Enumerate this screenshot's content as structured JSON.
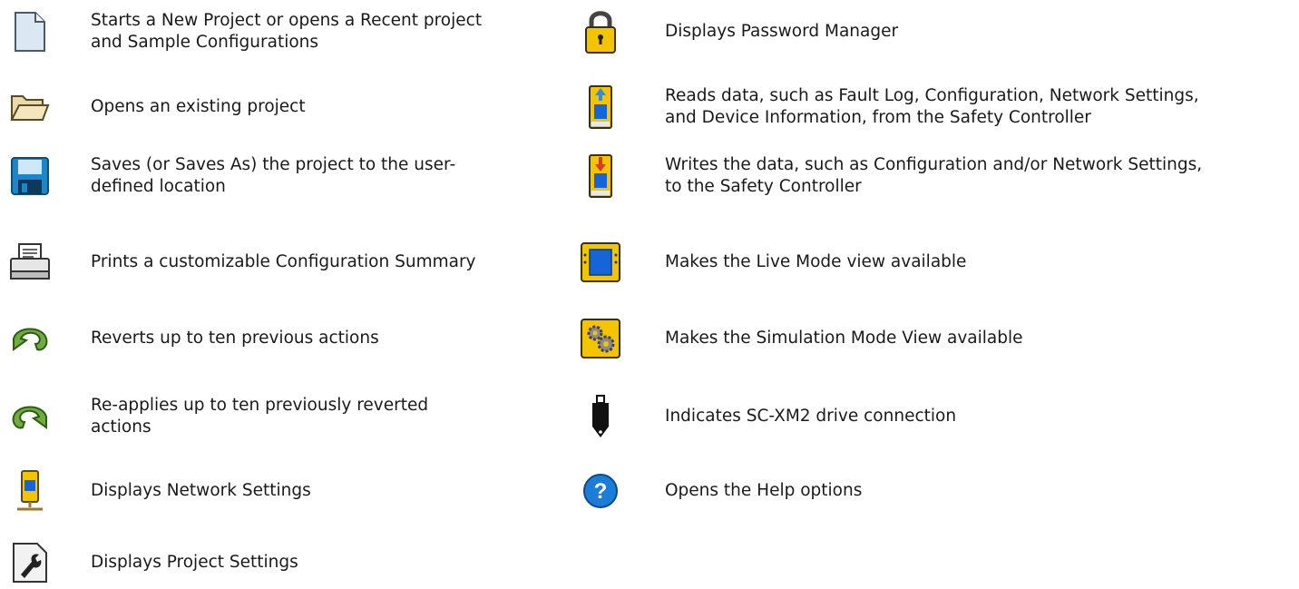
{
  "left": [
    {
      "icon": "new-project-icon",
      "line1": "Starts a New Project or opens a Recent project",
      "line2": "and Sample Configurations"
    },
    {
      "icon": "open-folder-icon",
      "line1": "Opens an existing project",
      "line2": ""
    },
    {
      "icon": "save-disk-icon",
      "line1": "Saves (or Saves As) the project to the user-",
      "line2": "defined location"
    },
    {
      "icon": "printer-icon",
      "line1": "Prints a customizable Configuration Summary",
      "line2": ""
    },
    {
      "icon": "undo-arrow-icon",
      "line1": "Reverts up to ten previous actions",
      "line2": ""
    },
    {
      "icon": "redo-arrow-icon",
      "line1": "Re-applies up to ten previously reverted",
      "line2": "actions"
    },
    {
      "icon": "network-settings-icon",
      "line1": "Displays Network Settings",
      "line2": ""
    },
    {
      "icon": "project-settings-icon",
      "line1": "Displays Project Settings",
      "line2": ""
    }
  ],
  "right": [
    {
      "icon": "padlock-icon",
      "line1": "Displays Password Manager",
      "line2": ""
    },
    {
      "icon": "read-from-controller-icon",
      "line1": "Reads data, such as Fault Log, Configuration, Network Settings,",
      "line2": "and Device Information, from the Safety Controller"
    },
    {
      "icon": "write-to-controller-icon",
      "line1": "Writes the data, such as Configuration and/or Network Settings,",
      "line2": "to the Safety Controller"
    },
    {
      "icon": "live-mode-icon",
      "line1": "Makes the Live Mode view available",
      "line2": ""
    },
    {
      "icon": "simulation-gears-icon",
      "line1": "Makes the Simulation Mode View available",
      "line2": ""
    },
    {
      "icon": "usb-drive-icon",
      "line1": "Indicates SC-XM2 drive connection",
      "line2": ""
    },
    {
      "icon": "help-icon",
      "line1": "Opens the Help options",
      "line2": ""
    }
  ],
  "colors": {
    "text": "#1a1a1a",
    "yellow": "#f5c400",
    "blue": "#1565d8",
    "green": "#5aa02c"
  }
}
